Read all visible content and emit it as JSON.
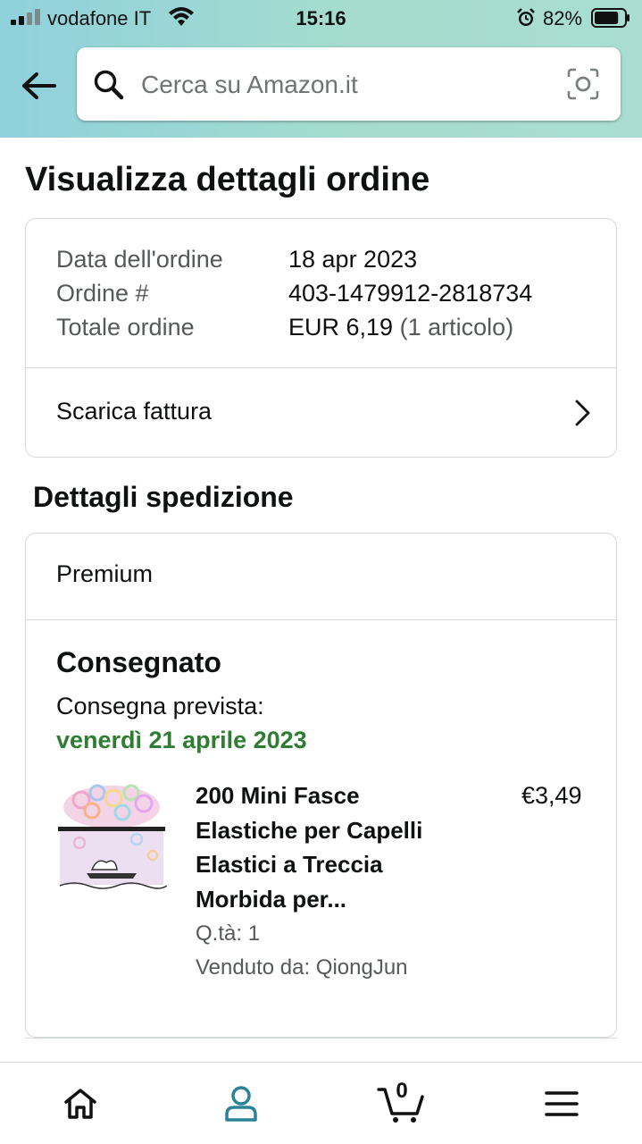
{
  "status_bar": {
    "carrier": "vodafone IT",
    "time": "15:16",
    "battery_percent": "82%",
    "battery_level": 0.82
  },
  "search": {
    "placeholder": "Cerca su Amazon.it"
  },
  "page": {
    "title": "Visualizza dettagli ordine"
  },
  "order_summary": {
    "rows": [
      {
        "label": "Data dell'ordine",
        "value": "18 apr 2023"
      },
      {
        "label": "Ordine #",
        "value": "403-1479912-2818734"
      },
      {
        "label": "Totale ordine",
        "value": "EUR 6,19",
        "extra": "(1 articolo)"
      }
    ],
    "invoice_label": "Scarica fattura"
  },
  "shipping": {
    "section_title": "Dettagli spedizione",
    "type": "Premium",
    "status": "Consegnato",
    "expected_label": "Consegna prevista:",
    "expected_date": "venerdì 21 aprile 2023",
    "item": {
      "title": "200 Mini Fasce Elastiche per Capelli Elastici a Treccia Morbida per...",
      "price": "€3,49",
      "quantity": "Q.tà: 1",
      "seller": "Venduto da: QiongJun"
    }
  },
  "tabbar": {
    "active": "you",
    "cart_count": "0"
  },
  "colors": {
    "accent": "#2a8299",
    "delivery_green": "#2e7d32",
    "header_gradient_start": "#8fd1dc",
    "header_gradient_end": "#a9ddd2"
  },
  "icons": [
    "cellular-signal-icon",
    "wifi-icon",
    "alarm-icon",
    "battery-icon",
    "back-arrow-icon",
    "search-icon",
    "camera-scan-icon",
    "chevron-right-icon",
    "home-icon",
    "profile-icon",
    "cart-icon",
    "menu-icon"
  ]
}
